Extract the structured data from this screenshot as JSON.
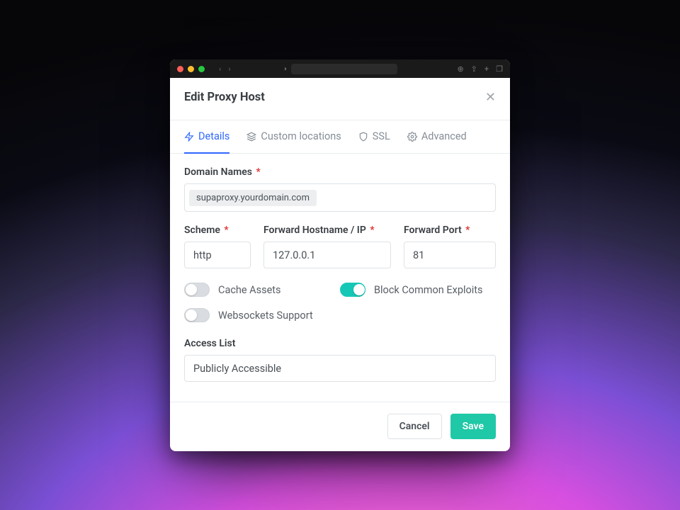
{
  "modal": {
    "title": "Edit Proxy Host"
  },
  "tabs": [
    {
      "id": "details",
      "label": "Details",
      "active": true
    },
    {
      "id": "custom",
      "label": "Custom locations",
      "active": false
    },
    {
      "id": "ssl",
      "label": "SSL",
      "active": false
    },
    {
      "id": "advanced",
      "label": "Advanced",
      "active": false
    }
  ],
  "fields": {
    "domain_names": {
      "label": "Domain Names",
      "required": true,
      "chip": "supaproxy.yourdomain.com"
    },
    "scheme": {
      "label": "Scheme",
      "required": true,
      "value": "http"
    },
    "forward_host": {
      "label": "Forward Hostname / IP",
      "required": true,
      "value": "127.0.0.1"
    },
    "forward_port": {
      "label": "Forward Port",
      "required": true,
      "value": "81"
    },
    "access_list": {
      "label": "Access List",
      "value": "Publicly Accessible"
    }
  },
  "toggles": {
    "cache_assets": {
      "label": "Cache Assets",
      "on": false
    },
    "block_exploits": {
      "label": "Block Common Exploits",
      "on": true
    },
    "websockets": {
      "label": "Websockets Support",
      "on": false
    }
  },
  "buttons": {
    "cancel": "Cancel",
    "save": "Save"
  },
  "colors": {
    "accent_blue": "#2f68ff",
    "accent_teal": "#1fc8a6",
    "toggle_on": "#17c7b6",
    "required": "#e03131"
  }
}
